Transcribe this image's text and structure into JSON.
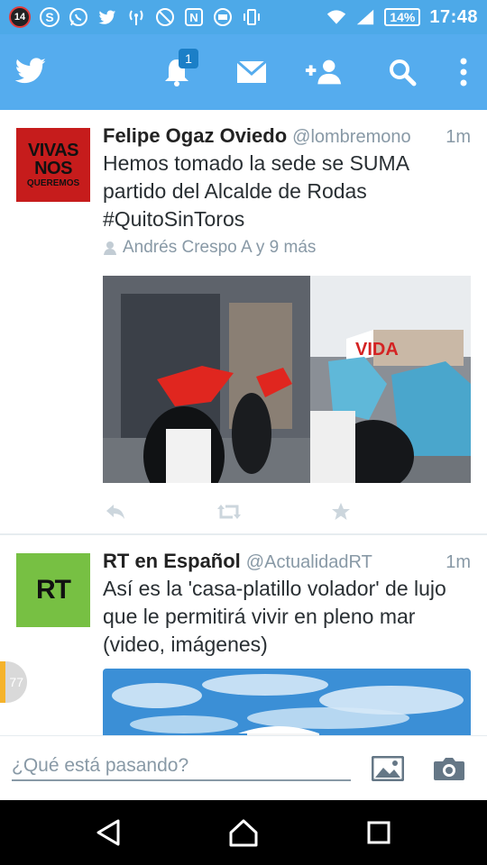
{
  "status_bar": {
    "notification_count": "14",
    "battery": "14%",
    "time": "17:48"
  },
  "app_bar": {
    "notifications_badge": "1",
    "icons": [
      "twitter-bird-icon",
      "bell-icon",
      "envelope-icon",
      "add-user-icon",
      "search-icon",
      "overflow-menu-icon"
    ]
  },
  "tweets": [
    {
      "avatar_lines": [
        "VIVAS",
        "NOS",
        "QUEREMOS"
      ],
      "name": "Felipe Ogaz Oviedo",
      "handle": "@lombremono",
      "time": "1m",
      "text": "Hemos tomado la sede se SUMA partido del Alcalde de Rodas #QuitoSinToros",
      "retweeted_by": "Andrés Crespo A y 9 más",
      "media_sign": "VIDA"
    },
    {
      "avatar_text": "RT",
      "name": "RT en Español",
      "handle": "@ActualidadRT",
      "time": "1m",
      "text": "Así es la 'casa-platillo volador' de lujo que le permitirá vivir en pleno mar (video, imágenes)"
    }
  ],
  "unread_count": "77",
  "compose": {
    "placeholder": "¿Qué está pasando?"
  },
  "colors": {
    "brand": "#55acee",
    "status_bar": "#4da9e8",
    "muted_text": "#8899a6",
    "avatar_red": "#d42323",
    "avatar_green": "#77c043"
  }
}
